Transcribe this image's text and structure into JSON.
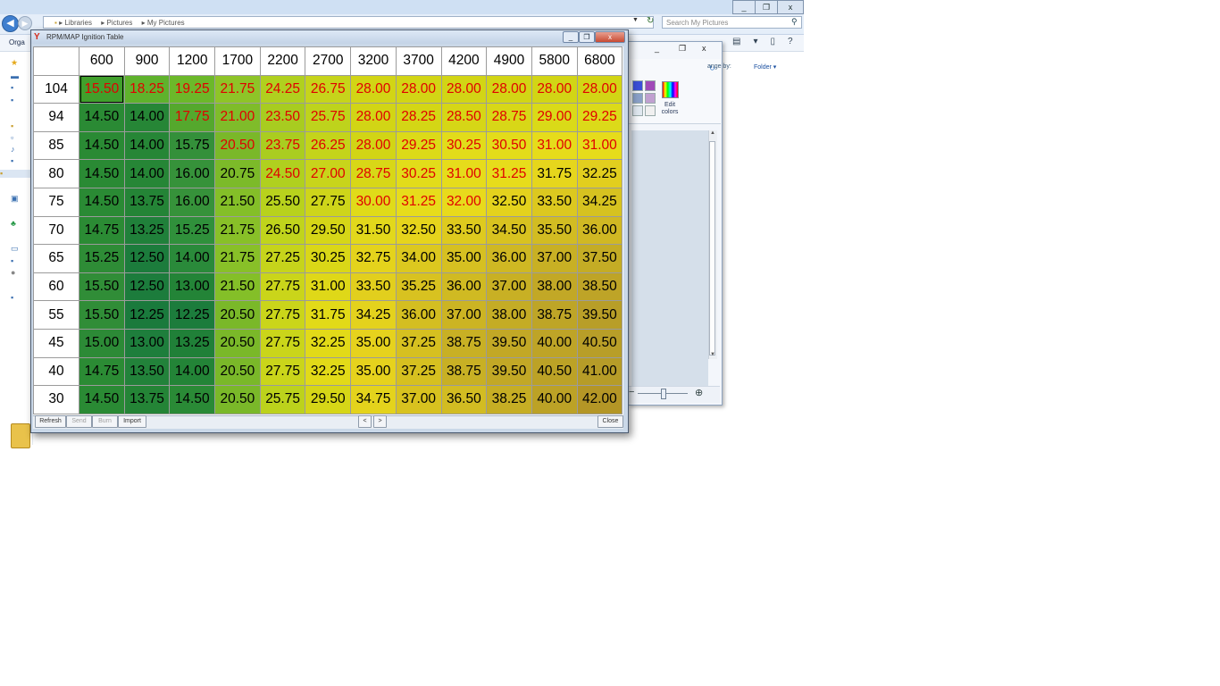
{
  "explorer": {
    "breadcrumbs": [
      "Libraries",
      "Pictures",
      "My Pictures"
    ],
    "search_placeholder": "Search My Pictures",
    "organize_label": "Orga",
    "caption_buttons": [
      "_",
      "❐",
      "x"
    ]
  },
  "paint": {
    "arrange_label": "ange by:",
    "folder_label": "Folder",
    "edit_colors_label": "Edit colors",
    "caption_buttons": [
      "_",
      "❐",
      "x"
    ],
    "swatch_colors": [
      "#3b4fd8",
      "#a04ab8",
      "#8aa0c8",
      "#c0a0d0",
      "#e0e8f0",
      "#f0f0f0"
    ]
  },
  "table_window": {
    "title": "RPM/MAP Ignition Table",
    "caption_buttons": [
      "_",
      "❐",
      "x"
    ],
    "columns": [
      "600",
      "900",
      "1200",
      "1700",
      "2200",
      "2700",
      "3200",
      "3700",
      "4200",
      "4900",
      "5800",
      "6800"
    ],
    "rows": [
      {
        "label": "104",
        "values": [
          "15.50",
          "18.25",
          "19.25",
          "21.75",
          "24.25",
          "26.75",
          "28.00",
          "28.00",
          "28.00",
          "28.00",
          "28.00",
          "28.00"
        ]
      },
      {
        "label": "94",
        "values": [
          "14.50",
          "14.00",
          "17.75",
          "21.00",
          "23.50",
          "25.75",
          "28.00",
          "28.25",
          "28.50",
          "28.75",
          "29.00",
          "29.25"
        ]
      },
      {
        "label": "85",
        "values": [
          "14.50",
          "14.00",
          "15.75",
          "20.50",
          "23.75",
          "26.25",
          "28.00",
          "29.25",
          "30.25",
          "30.50",
          "31.00",
          "31.00"
        ]
      },
      {
        "label": "80",
        "values": [
          "14.50",
          "14.00",
          "16.00",
          "20.75",
          "24.50",
          "27.00",
          "28.75",
          "30.25",
          "31.00",
          "31.25",
          "31.75",
          "32.25"
        ]
      },
      {
        "label": "75",
        "values": [
          "14.50",
          "13.75",
          "16.00",
          "21.50",
          "25.50",
          "27.75",
          "30.00",
          "31.25",
          "32.00",
          "32.50",
          "33.50",
          "34.25"
        ]
      },
      {
        "label": "70",
        "values": [
          "14.75",
          "13.25",
          "15.25",
          "21.75",
          "26.50",
          "29.50",
          "31.50",
          "32.50",
          "33.50",
          "34.50",
          "35.50",
          "36.00"
        ]
      },
      {
        "label": "65",
        "values": [
          "15.25",
          "12.50",
          "14.00",
          "21.75",
          "27.25",
          "30.25",
          "32.75",
          "34.00",
          "35.00",
          "36.00",
          "37.00",
          "37.50"
        ]
      },
      {
        "label": "60",
        "values": [
          "15.50",
          "12.50",
          "13.00",
          "21.50",
          "27.75",
          "31.00",
          "33.50",
          "35.25",
          "36.00",
          "37.00",
          "38.00",
          "38.50"
        ]
      },
      {
        "label": "55",
        "values": [
          "15.50",
          "12.25",
          "12.25",
          "20.50",
          "27.75",
          "31.75",
          "34.25",
          "36.00",
          "37.00",
          "38.00",
          "38.75",
          "39.50"
        ]
      },
      {
        "label": "45",
        "values": [
          "15.00",
          "13.00",
          "13.25",
          "20.50",
          "27.75",
          "32.25",
          "35.00",
          "37.25",
          "38.75",
          "39.50",
          "40.00",
          "40.50"
        ]
      },
      {
        "label": "40",
        "values": [
          "14.75",
          "13.50",
          "14.00",
          "20.50",
          "27.75",
          "32.25",
          "35.00",
          "37.25",
          "38.75",
          "39.50",
          "40.50",
          "41.00"
        ]
      },
      {
        "label": "30",
        "values": [
          "14.50",
          "13.75",
          "14.50",
          "20.50",
          "25.75",
          "29.50",
          "34.75",
          "37.00",
          "36.50",
          "38.25",
          "40.00",
          "42.00"
        ]
      }
    ],
    "red_text_cells": [
      [
        0,
        0
      ],
      [
        0,
        1
      ],
      [
        0,
        2
      ],
      [
        0,
        3
      ],
      [
        0,
        4
      ],
      [
        0,
        5
      ],
      [
        0,
        6
      ],
      [
        0,
        7
      ],
      [
        0,
        8
      ],
      [
        0,
        9
      ],
      [
        0,
        10
      ],
      [
        0,
        11
      ],
      [
        1,
        2
      ],
      [
        1,
        3
      ],
      [
        1,
        4
      ],
      [
        1,
        5
      ],
      [
        1,
        6
      ],
      [
        1,
        7
      ],
      [
        1,
        8
      ],
      [
        1,
        9
      ],
      [
        1,
        10
      ],
      [
        1,
        11
      ],
      [
        2,
        3
      ],
      [
        2,
        4
      ],
      [
        2,
        5
      ],
      [
        2,
        6
      ],
      [
        2,
        7
      ],
      [
        2,
        8
      ],
      [
        2,
        9
      ],
      [
        2,
        10
      ],
      [
        2,
        11
      ],
      [
        3,
        4
      ],
      [
        3,
        5
      ],
      [
        3,
        6
      ],
      [
        3,
        7
      ],
      [
        3,
        8
      ],
      [
        3,
        9
      ],
      [
        4,
        6
      ],
      [
        4,
        7
      ],
      [
        4,
        8
      ]
    ],
    "cell_colors": [
      [
        "#41a02c",
        "#5fb22c",
        "#6cb82a",
        "#8ec428",
        "#b0d01f",
        "#c6d41b",
        "#d2d515",
        "#d2d515",
        "#d2d515",
        "#d2d515",
        "#d2d515",
        "#d2d515"
      ],
      [
        "#2a8a34",
        "#268636",
        "#55a82d",
        "#7fbc2a",
        "#a8cc20",
        "#bed31c",
        "#d2d515",
        "#d4d615",
        "#d6d616",
        "#d8d717",
        "#dada18",
        "#dcda19"
      ],
      [
        "#2a8a34",
        "#268636",
        "#34903a",
        "#7ab829",
        "#aacd20",
        "#c4d41b",
        "#d2d515",
        "#dcda18",
        "#e2dc1a",
        "#e3dc1a",
        "#e6dc1b",
        "#e6dc1b"
      ],
      [
        "#2a8a34",
        "#268636",
        "#36923a",
        "#7cba29",
        "#b0d01f",
        "#c8d41b",
        "#d8d717",
        "#e2dc1a",
        "#e6dc1b",
        "#e7dc1b",
        "#e6d61c",
        "#e2ce1e"
      ],
      [
        "#2a8a34",
        "#248436",
        "#36923a",
        "#84bf28",
        "#b8d21d",
        "#ced51a",
        "#e0db19",
        "#e7dc1b",
        "#e8da1c",
        "#e4d21d",
        "#dcc81f",
        "#d6c220"
      ],
      [
        "#2b8b34",
        "#20803a",
        "#30903b",
        "#88c028",
        "#c0d41c",
        "#d6d617",
        "#e2d81b",
        "#e6d41c",
        "#deca1e",
        "#d8c220",
        "#d2bc22",
        "#d0b823"
      ],
      [
        "#2e8c36",
        "#1c7c3c",
        "#2a8a3a",
        "#88c028",
        "#c6d41b",
        "#dad717",
        "#e4d31c",
        "#dcc81f",
        "#d6c021",
        "#cfb823",
        "#c8b024",
        "#c4ac25"
      ],
      [
        "#308d37",
        "#1c7c3c",
        "#238437",
        "#84bf28",
        "#cad51a",
        "#dfd818",
        "#e2cf1d",
        "#d8c220",
        "#d0ba22",
        "#c8b024",
        "#c2a826",
        "#bea427"
      ],
      [
        "#308d37",
        "#1a7a3c",
        "#1c7c3c",
        "#7ab829",
        "#cad51a",
        "#e2da18",
        "#e4d21d",
        "#d4be21",
        "#ccb423",
        "#c4ac25",
        "#be a527",
        "#b89e28"
      ],
      [
        "#2c8a36",
        "#1e7e3c",
        "#208038",
        "#7ab829",
        "#cad51a",
        "#e2da18",
        "#e6d21d",
        "#d6c020",
        "#c8b024",
        "#c2a826",
        "#bea427",
        "#b89e28"
      ],
      [
        "#2b8b34",
        "#22823a",
        "#238437",
        "#7ab829",
        "#cad51a",
        "#e2da18",
        "#e6d21d",
        "#d6c020",
        "#c8b024",
        "#c2a826",
        "#bca226",
        "#b69c28"
      ],
      [
        "#2a8a34",
        "#248436",
        "#2a8a36",
        "#7ab829",
        "#bcd21c",
        "#d6d617",
        "#e4d31c",
        "#d8c21f",
        "#d2bc22",
        "#c6ae24",
        "#bca226",
        "#b49626"
      ]
    ],
    "selected_cell": [
      0,
      0
    ],
    "bottom_buttons": [
      {
        "label": "Refresh",
        "enabled": true
      },
      {
        "label": "Send",
        "enabled": false
      },
      {
        "label": "Burn",
        "enabled": false
      },
      {
        "label": "Import",
        "enabled": true
      }
    ],
    "close_label": "Close",
    "nav_left": "<",
    "nav_right": ">"
  }
}
